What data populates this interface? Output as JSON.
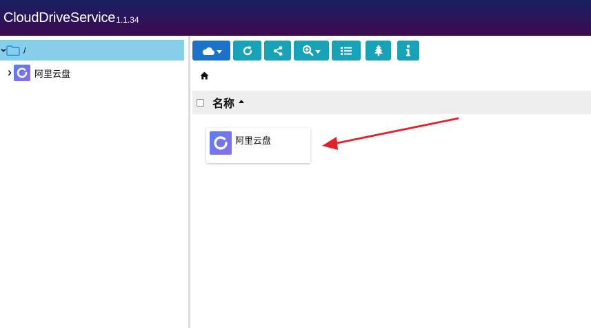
{
  "header": {
    "title": "CloudDriveService",
    "version": "1.1.34"
  },
  "sidebar": {
    "root": {
      "label": "/",
      "icon": "folder-icon",
      "expanded": true
    },
    "children": [
      {
        "label": "阿里云盘",
        "icon": "aliyun-drive-icon",
        "expanded": false
      }
    ]
  },
  "toolbar": {
    "buttons": [
      {
        "icon": "cloud-icon",
        "has_dropdown": true,
        "color": "#1a73c8"
      },
      {
        "icon": "refresh-icon",
        "has_dropdown": false,
        "color": "#17a2b8"
      },
      {
        "icon": "share-icon",
        "has_dropdown": false,
        "color": "#17a2b8"
      },
      {
        "icon": "zoom-icon",
        "has_dropdown": true,
        "color": "#17a2b8"
      },
      {
        "icon": "list-icon",
        "has_dropdown": false,
        "color": "#17a2b8"
      },
      {
        "icon": "tree-icon",
        "has_dropdown": false,
        "color": "#17a2b8"
      },
      {
        "icon": "info-icon",
        "has_dropdown": false,
        "color": "#17a2b8"
      }
    ]
  },
  "breadcrumb": {
    "icon": "home-icon"
  },
  "file_list": {
    "column_header": "名称",
    "sort": "ascending",
    "items": [
      {
        "name": "阿里云盘",
        "icon": "aliyun-drive-icon"
      }
    ]
  },
  "colors": {
    "header_gradient_start": "#16215f",
    "header_gradient_end": "#3c0b4e",
    "selected_row": "#87ceeb",
    "toolbar_info": "#17a2b8",
    "toolbar_primary": "#1a73c8",
    "annotation_arrow": "#e3202a"
  }
}
